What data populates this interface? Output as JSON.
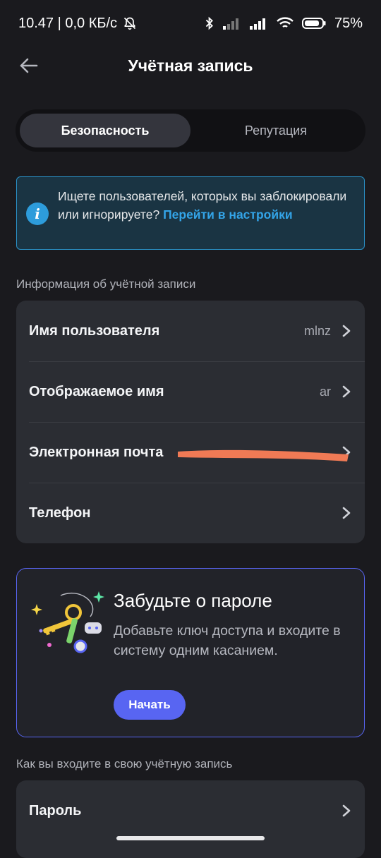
{
  "status_bar": {
    "time_speed": "10.47 | 0,0 КБ/с",
    "battery": "75%"
  },
  "header": {
    "title": "Учётная запись"
  },
  "tabs": [
    {
      "label": "Безопасность",
      "active": true
    },
    {
      "label": "Репутация",
      "active": false
    }
  ],
  "info_banner": {
    "text": "Ищете пользователей, которых вы заблокировали или игнорируете? ",
    "link": "Перейти в настройки"
  },
  "account_info": {
    "section_title": "Информация об учётной записи",
    "rows": [
      {
        "label": "Имя пользователя",
        "value": "mlnz"
      },
      {
        "label": "Отображаемое имя",
        "value": "ar"
      },
      {
        "label": "Электронная почта",
        "value": ""
      },
      {
        "label": "Телефон",
        "value": ""
      }
    ]
  },
  "passkey_promo": {
    "title": "Забудьте о пароле",
    "body": "Добавьте ключ доступа и входите в систему одним касанием.",
    "button": "Начать"
  },
  "login_section": {
    "section_title": "Как вы входите в свою учётную запись",
    "rows": [
      {
        "label": "Пароль"
      }
    ]
  },
  "colors": {
    "background": "#1a1a1e",
    "card": "#2b2d33",
    "accent": "#5865f2",
    "info_border": "#2a91c7",
    "link": "#33a4e8"
  }
}
